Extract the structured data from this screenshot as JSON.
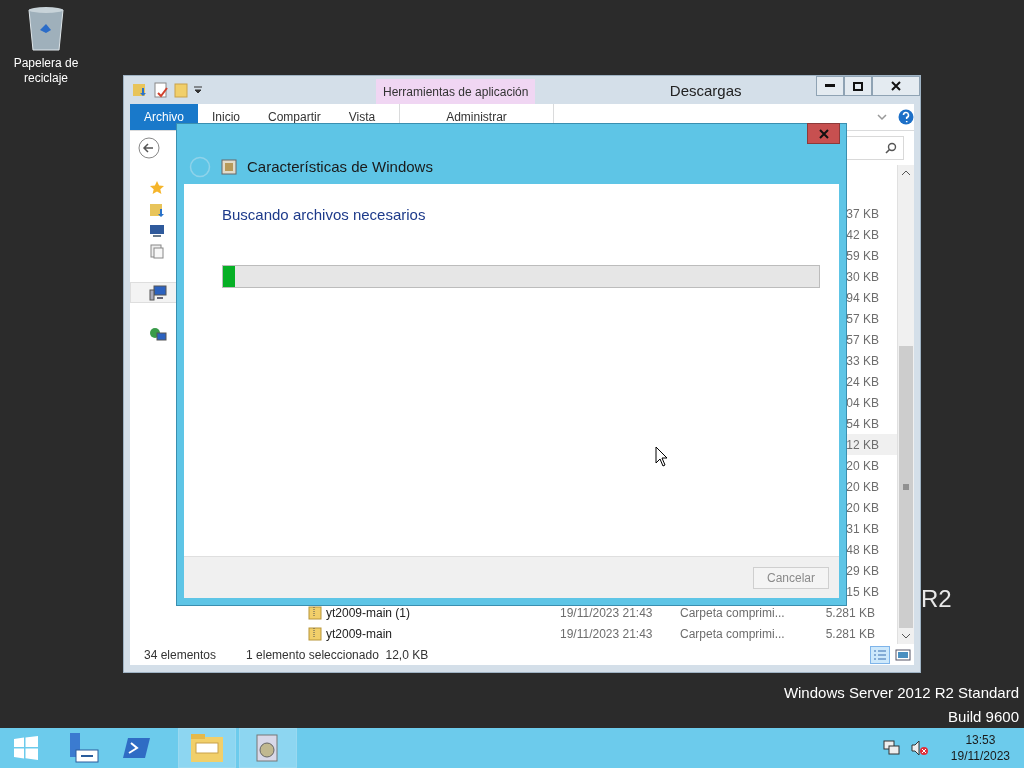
{
  "desktop": {
    "icons": [
      {
        "label": "Papelera de reciclaje"
      }
    ],
    "branding": {
      "logo_tail": "R2",
      "edition": "Windows Server 2012 R2 Standard",
      "build": "Build 9600"
    }
  },
  "explorer": {
    "title": "Descargas",
    "contextual_group": "Herramientas de aplicación",
    "ribbon_tabs": [
      {
        "label": "Archivo",
        "kind": "file",
        "selected": false
      },
      {
        "label": "Inicio",
        "kind": "tab",
        "selected": false
      },
      {
        "label": "Compartir",
        "kind": "tab",
        "selected": false
      },
      {
        "label": "Vista",
        "kind": "tab",
        "selected": false
      },
      {
        "label": "Administrar",
        "kind": "contextual",
        "selected": false
      }
    ],
    "nav_items": [
      {
        "kind": "favorites",
        "selected": false
      },
      {
        "kind": "downloads",
        "selected": false
      },
      {
        "kind": "desktop",
        "selected": false
      },
      {
        "kind": "recent",
        "selected": false
      },
      {
        "kind": "computer",
        "selected": true
      },
      {
        "kind": "network",
        "selected": false
      }
    ],
    "rows": [
      {
        "size": "37 KB",
        "selected": false
      },
      {
        "size": "42 KB",
        "selected": false
      },
      {
        "size": "59 KB",
        "selected": false
      },
      {
        "size": "30 KB",
        "selected": false
      },
      {
        "size": "94 KB",
        "selected": false
      },
      {
        "size": "57 KB",
        "selected": false
      },
      {
        "size": "57 KB",
        "selected": false
      },
      {
        "size": "33 KB",
        "selected": false
      },
      {
        "size": "24 KB",
        "selected": false
      },
      {
        "size": "04 KB",
        "selected": false
      },
      {
        "size": "54 KB",
        "selected": false
      },
      {
        "size": "12 KB",
        "selected": true
      },
      {
        "size": "20 KB",
        "selected": false
      },
      {
        "size": "20 KB",
        "selected": false
      },
      {
        "size": "20 KB",
        "selected": false
      },
      {
        "size": "31 KB",
        "selected": false
      },
      {
        "size": "48 KB",
        "selected": false
      },
      {
        "size": "29 KB",
        "selected": false
      },
      {
        "size": "15 KB",
        "selected": false
      },
      {
        "name": "yt2009-main (1)",
        "date": "19/11/2023 21:43",
        "type": "Carpeta comprimi...",
        "size": "5.281 KB",
        "selected": false
      },
      {
        "name": "yt2009-main",
        "date": "19/11/2023 21:43",
        "type": "Carpeta comprimi...",
        "size": "5.281 KB",
        "selected": false
      }
    ],
    "status": {
      "count": "34 elementos",
      "selection": "1 elemento seleccionado  12,0 KB"
    }
  },
  "dialog": {
    "title": "Características de Windows",
    "heading": "Buscando archivos necesarios",
    "progress": {
      "level": 0.02
    },
    "buttons": [
      {
        "label": "Cancelar",
        "disabled": true
      }
    ]
  },
  "taskbar": {
    "items": [
      {
        "kind": "start",
        "selected": false
      },
      {
        "kind": "server-manager",
        "selected": false
      },
      {
        "kind": "powershell",
        "selected": false
      },
      {
        "kind": "explorer",
        "selected": true
      },
      {
        "kind": "features",
        "selected": true
      }
    ],
    "clock": {
      "time": "13:53",
      "date": "19/11/2023"
    }
  }
}
